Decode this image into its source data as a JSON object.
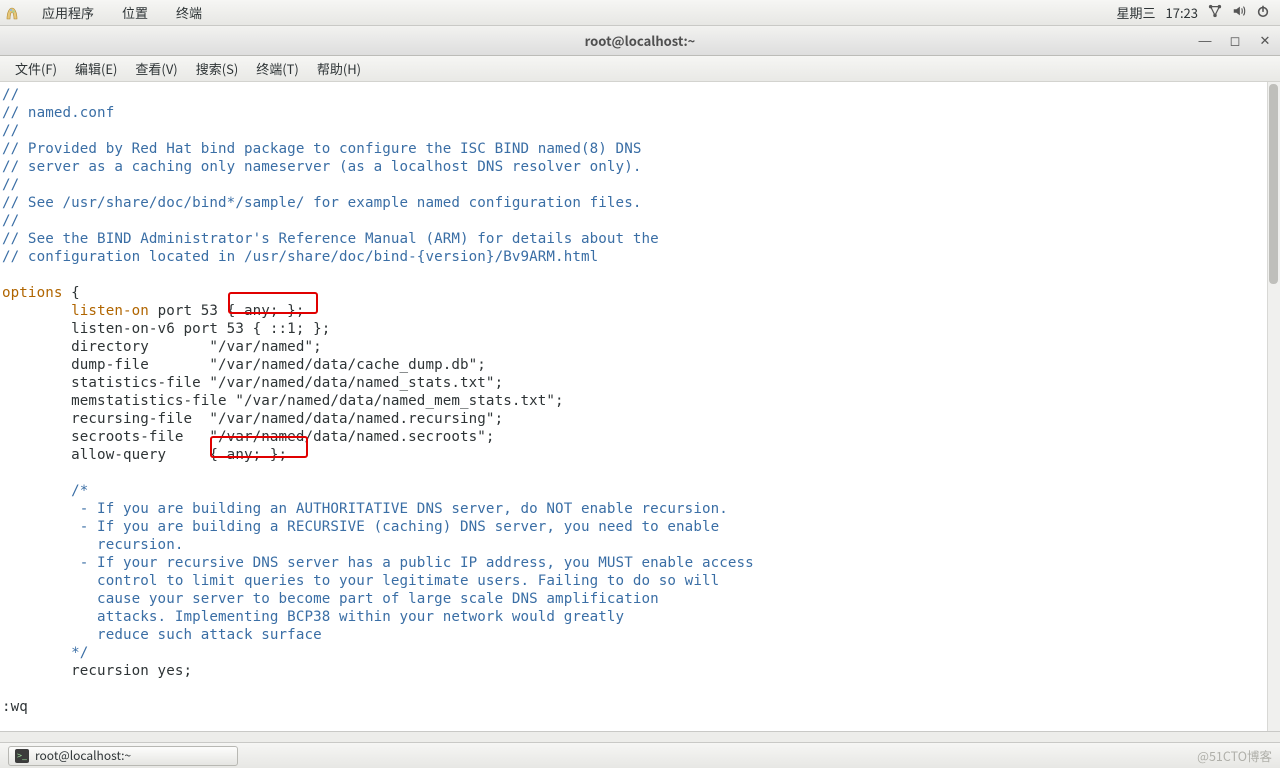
{
  "top_panel": {
    "app_menu": "应用程序",
    "places": "位置",
    "terminal": "终端",
    "date": "星期三",
    "time": "17:23"
  },
  "window": {
    "title": "root@localhost:~"
  },
  "menubar": {
    "file": "文件(F)",
    "edit": "编辑(E)",
    "view": "查看(V)",
    "search": "搜索(S)",
    "terminal": "终端(T)",
    "help": "帮助(H)"
  },
  "editor": {
    "line01": "//",
    "line02": "// named.conf",
    "line03": "//",
    "line04": "// Provided by Red Hat bind package to configure the ISC BIND named(8) DNS",
    "line05": "// server as a caching only nameserver (as a localhost DNS resolver only).",
    "line06": "//",
    "line07": "// See /usr/share/doc/bind*/sample/ for example named configuration files.",
    "line08": "//",
    "line09": "// See the BIND Administrator's Reference Manual (ARM) for details about the",
    "line10": "// configuration located in /usr/share/doc/bind-{version}/Bv9ARM.html",
    "line_blank": "",
    "options_kw": "options",
    "brace_open": " {",
    "indent": "        ",
    "listen_on_kw": "listen-on",
    "listen_on_rest": " port 53 { any; };",
    "listen_on_v6": "        listen-on-v6 port 53 { ::1; };",
    "directory": "        directory       \"/var/named\";",
    "dump_file": "        dump-file       \"/var/named/data/cache_dump.db\";",
    "stats_file": "        statistics-file \"/var/named/data/named_stats.txt\";",
    "mem_stats": "        memstatistics-file \"/var/named/data/named_mem_stats.txt\";",
    "recursing": "        recursing-file  \"/var/named/data/named.recursing\";",
    "secroots": "        secroots-file   \"/var/named/data/named.secroots\";",
    "allow_query": "        allow-query     { any; };",
    "cmt_open": "        /*",
    "cmt_l1": "         - If you are building an AUTHORITATIVE DNS server, do NOT enable recursion.",
    "cmt_l2": "         - If you are building a RECURSIVE (caching) DNS server, you need to enable",
    "cmt_l3": "           recursion.",
    "cmt_l4": "         - If your recursive DNS server has a public IP address, you MUST enable access",
    "cmt_l5": "           control to limit queries to your legitimate users. Failing to do so will",
    "cmt_l6": "           cause your server to become part of large scale DNS amplification",
    "cmt_l7": "           attacks. Implementing BCP38 within your network would greatly",
    "cmt_l8": "           reduce such attack surface",
    "cmt_close": "        */",
    "recursion": "        recursion yes;",
    "ex_cmd": ":wq"
  },
  "taskbar": {
    "task_label": "root@localhost:~",
    "watermark": "@51CTO博客"
  },
  "icons": {
    "network": "network-icon",
    "volume": "volume-icon",
    "power": "power-icon",
    "apps": "apps-icon"
  }
}
